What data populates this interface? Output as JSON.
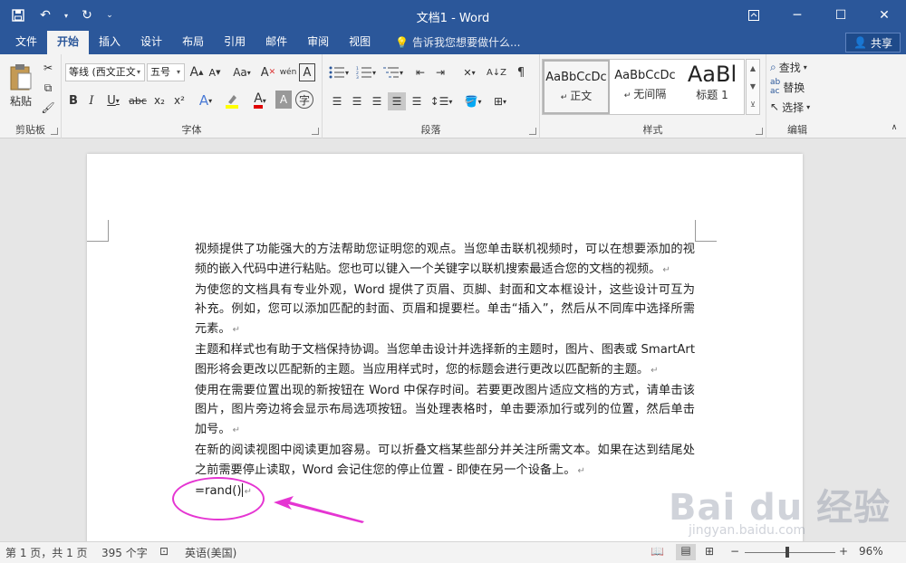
{
  "window": {
    "title": "文档1 - Word"
  },
  "tabs": [
    "文件",
    "开始",
    "插入",
    "设计",
    "布局",
    "引用",
    "邮件",
    "审阅",
    "视图"
  ],
  "tellme": "告诉我您想要做什么...",
  "share": "共享",
  "ribbon": {
    "clipboard": {
      "paste": "粘贴",
      "label": "剪贴板"
    },
    "font": {
      "font_name": "等线 (西文正文",
      "font_size": "五号",
      "label": "字体",
      "bold": "B",
      "italic": "I",
      "underline": "U",
      "strike": "abc",
      "subscript": "x₂",
      "superscript": "x²",
      "grow": "A",
      "shrink": "A",
      "case": "Aa",
      "wen": "wén",
      "border_a": "A"
    },
    "paragraph": {
      "label": "段落"
    },
    "styles": {
      "label": "样式",
      "items": [
        {
          "preview": "AaBbCcDc",
          "name": "正文"
        },
        {
          "preview": "AaBbCcDc",
          "name": "无间隔"
        },
        {
          "preview": "AaBl",
          "name": "标题 1"
        }
      ]
    },
    "editing": {
      "find": "查找",
      "replace": "替换",
      "select": "选择",
      "label": "编辑"
    }
  },
  "document": {
    "paragraphs": [
      "视频提供了功能强大的方法帮助您证明您的观点。当您单击联机视频时，可以在想要添加的视频的嵌入代码中进行粘贴。您也可以键入一个关键字以联机搜索最适合您的文档的视频。",
      "为使您的文档具有专业外观，Word 提供了页眉、页脚、封面和文本框设计，这些设计可互为补充。例如，您可以添加匹配的封面、页眉和提要栏。单击“插入”，然后从不同库中选择所需元素。",
      "主题和样式也有助于文档保持协调。当您单击设计并选择新的主题时，图片、图表或 SmartArt 图形将会更改以匹配新的主题。当应用样式时，您的标题会进行更改以匹配新的主题。",
      "使用在需要位置出现的新按钮在 Word 中保存时间。若要更改图片适应文档的方式，请单击该图片，图片旁边将会显示布局选项按钮。当处理表格时，单击要添加行或列的位置，然后单击加号。",
      "在新的阅读视图中阅读更加容易。可以折叠文档某些部分并关注所需文本。如果在达到结尾处之前需要停止读取，Word 会记住您的停止位置 - 即使在另一个设备上。"
    ],
    "formula": "=rand()",
    "para_mark": "↵"
  },
  "watermark": {
    "main": "Bai du 经验",
    "sub": "jingyan.baidu.com"
  },
  "status": {
    "page": "第 1 页，共 1 页",
    "words": "395 个字",
    "language": "英语(美国)",
    "zoom": "96%"
  },
  "colors": {
    "titlebar": "#2b579a",
    "annotation": "#e535d2",
    "highlight": "#ffff00",
    "font_color": "#e00000"
  }
}
